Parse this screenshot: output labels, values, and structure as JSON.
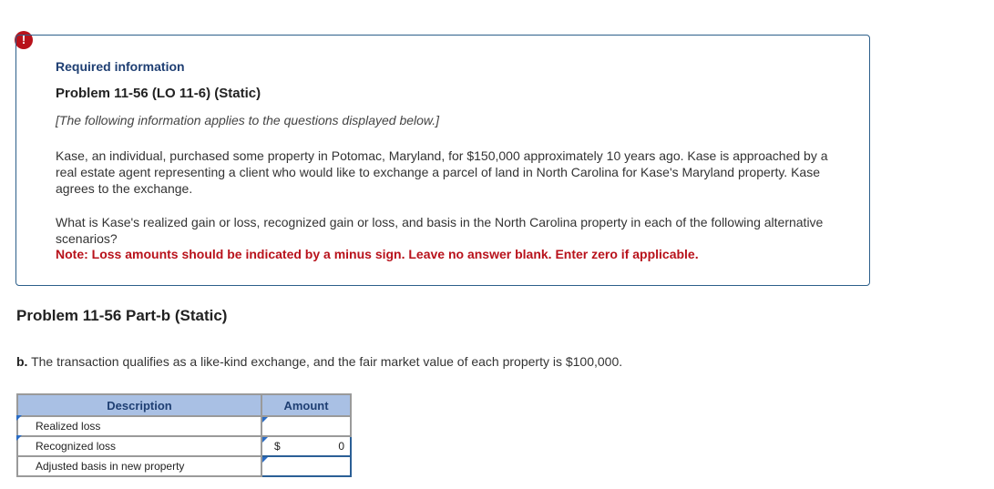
{
  "alert": {
    "icon": "exclamation-icon",
    "symbol": "!",
    "color": "#b8121b"
  },
  "info": {
    "required_label": "Required information",
    "problem_title": "Problem 11-56 (LO 11-6) (Static)",
    "applies_note": "[The following information applies to the questions displayed below.]",
    "paragraph1": "Kase, an individual, purchased some property in Potomac, Maryland, for $150,000 approximately 10 years ago. Kase is approached by a real estate agent representing a client who would like to exchange a parcel of land in North Carolina for Kase's Maryland property. Kase agrees to the exchange.",
    "paragraph2": "What is Kase's realized gain or loss, recognized gain or loss, and basis in the North Carolina property in each of the following alternative scenarios?",
    "note": "Note: Loss amounts should be indicated by a minus sign. Leave no answer blank. Enter zero if applicable."
  },
  "part": {
    "title": "Problem 11-56 Part-b (Static)",
    "question_prefix": "b.",
    "question_text": " The transaction qualifies as a like-kind exchange, and the fair market value of each property is $100,000."
  },
  "table": {
    "headers": {
      "description": "Description",
      "amount": "Amount"
    },
    "rows": [
      {
        "label": "Realized loss",
        "currency": "",
        "value": ""
      },
      {
        "label": "Recognized loss",
        "currency": "$",
        "value": "0"
      },
      {
        "label": "Adjusted basis in new property",
        "currency": "",
        "value": ""
      }
    ]
  },
  "colors": {
    "border_blue": "#2c5f8a",
    "header_blue": "#a9c0e4",
    "note_red": "#b8121b",
    "title_navy": "#1f3f73"
  }
}
